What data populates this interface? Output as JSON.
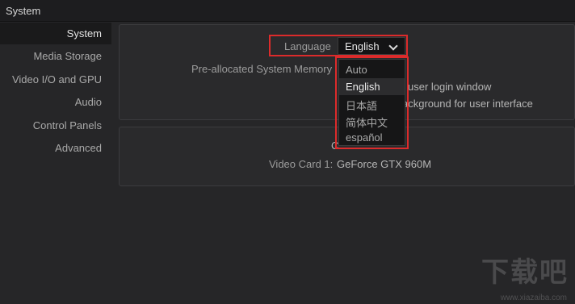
{
  "window": {
    "title": "System"
  },
  "sidebar": {
    "items": [
      {
        "label": "System",
        "active": true
      },
      {
        "label": "Media Storage",
        "active": false
      },
      {
        "label": "Video I/O and GPU",
        "active": false
      },
      {
        "label": "Audio",
        "active": false
      },
      {
        "label": "Control Panels",
        "active": false
      },
      {
        "label": "Advanced",
        "active": false
      }
    ]
  },
  "settings": {
    "language_label": "Language",
    "language_value": "English",
    "memory_label": "Pre-allocated System Memory",
    "login_window_text": "user login window",
    "background_text": "ackground for user interface",
    "partial_c": "C",
    "video_card_label": "Video Card 1:",
    "video_card_value": "GeForce GTX 960M"
  },
  "language_dropdown": {
    "options": [
      "Auto",
      "English",
      "日本語",
      "简体中文",
      "español"
    ],
    "selected": "English"
  },
  "watermark": {
    "text": "下载吧",
    "url": "www.xiazaiba.com"
  },
  "colors": {
    "highlight": "#dc2b2b",
    "background": "#262628",
    "panel": "#2a2a2c"
  }
}
